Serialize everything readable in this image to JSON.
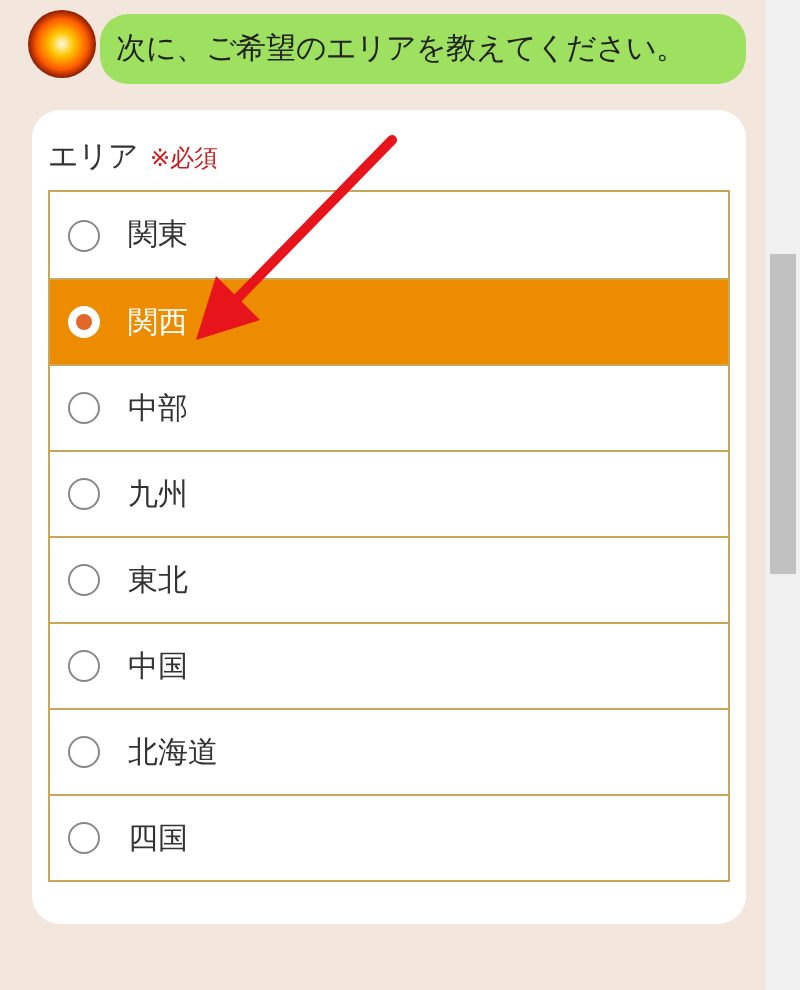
{
  "message": {
    "text": "次に、ご希望のエリアを教えてください。"
  },
  "form": {
    "label": "エリア",
    "required": "※必須",
    "options": [
      {
        "label": "関東",
        "selected": false
      },
      {
        "label": "関西",
        "selected": true
      },
      {
        "label": "中部",
        "selected": false
      },
      {
        "label": "九州",
        "selected": false
      },
      {
        "label": "東北",
        "selected": false
      },
      {
        "label": "中国",
        "selected": false
      },
      {
        "label": "北海道",
        "selected": false
      },
      {
        "label": "四国",
        "selected": false
      }
    ]
  }
}
